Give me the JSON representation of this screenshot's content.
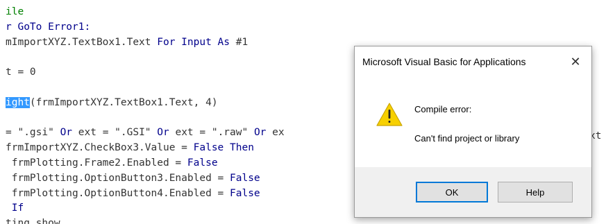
{
  "editor": {
    "lines": [
      [
        {
          "t": "ile",
          "c": "cm"
        }
      ],
      [
        {
          "t": "r GoTo Error1:",
          "c": "kw"
        }
      ],
      [
        {
          "t": "mImportXYZ.TextBox1.Text ",
          "c": ""
        },
        {
          "t": "For Input As",
          "c": "kw"
        },
        {
          "t": " #1",
          "c": ""
        }
      ],
      [
        {
          "t": "",
          "c": ""
        }
      ],
      [
        {
          "t": "t = 0",
          "c": ""
        }
      ],
      [
        {
          "t": "",
          "c": ""
        }
      ],
      [
        {
          "t": "ight",
          "c": "sel"
        },
        {
          "t": "(frmImportXYZ.TextBox1.Text, 4)",
          "c": ""
        }
      ],
      [
        {
          "t": "",
          "c": ""
        }
      ],
      [
        {
          "t": "= \".gsi\" ",
          "c": ""
        },
        {
          "t": "Or",
          "c": "kw"
        },
        {
          "t": " ext = \".GSI\" ",
          "c": ""
        },
        {
          "t": "Or",
          "c": "kw"
        },
        {
          "t": " ext = \".raw\" ",
          "c": ""
        },
        {
          "t": "Or",
          "c": "kw"
        },
        {
          "t": " ex",
          "c": ""
        }
      ],
      [
        {
          "t": "frmImportXYZ.CheckBox3.Value = ",
          "c": ""
        },
        {
          "t": "False Then",
          "c": "kw"
        }
      ],
      [
        {
          "t": " frmPlotting.Frame2.Enabled = ",
          "c": ""
        },
        {
          "t": "False",
          "c": "kw"
        }
      ],
      [
        {
          "t": " frmPlotting.OptionButton3.Enabled = ",
          "c": ""
        },
        {
          "t": "False",
          "c": "kw"
        }
      ],
      [
        {
          "t": " frmPlotting.OptionButton4.Enabled = ",
          "c": ""
        },
        {
          "t": "False",
          "c": "kw"
        }
      ],
      [
        {
          "t": " If",
          "c": "kw"
        }
      ],
      [
        {
          "t": "ting.show",
          "c": ""
        }
      ]
    ],
    "right_fragment": "xt"
  },
  "dialog": {
    "title": "Microsoft Visual Basic for Applications",
    "close_glyph": "✕",
    "message_line1": "Compile error:",
    "message_line2": "Can't find project or library",
    "ok_label": "OK",
    "help_label": "Help"
  },
  "colors": {
    "keyword": "#00008B",
    "comment": "#008000",
    "selection": "#3399FF",
    "warning_yellow": "#F7D000",
    "ok_border": "#0078d7"
  }
}
